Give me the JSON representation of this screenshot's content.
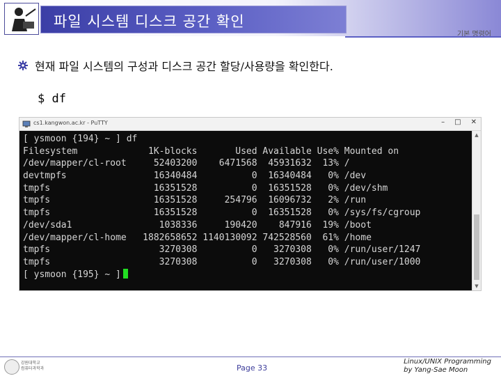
{
  "header": {
    "title": "파일 시스템 디스크 공간 확인",
    "tagline": "기본 명령어"
  },
  "bullet": {
    "text": "현재 파일 시스템의 구성과 디스크 공간 할당/사용량을 확인한다."
  },
  "command": {
    "text": "$ df"
  },
  "window": {
    "title": "cs1.kangwon.ac.kr - PuTTY",
    "controls": {
      "minimize": "–",
      "maximize": "□",
      "close": "✕"
    }
  },
  "terminal": {
    "lines": [
      "[ ysmoon {194} ~ ] df",
      "Filesystem             1K-blocks       Used Available Use% Mounted on",
      "/dev/mapper/cl-root     52403200    6471568  45931632  13% /",
      "devtmpfs                16340484          0  16340484   0% /dev",
      "tmpfs                   16351528          0  16351528   0% /dev/shm",
      "tmpfs                   16351528     254796  16096732   2% /run",
      "tmpfs                   16351528          0  16351528   0% /sys/fs/cgroup",
      "/dev/sda1                1038336     190420    847916  19% /boot",
      "/dev/mapper/cl-home   1882658652 1140130092 742528560  61% /home",
      "tmpfs                    3270308          0   3270308   0% /run/user/1247",
      "tmpfs                    3270308          0   3270308   0% /run/user/1000"
    ],
    "prompt": "[ ysmoon {195} ~ ]"
  },
  "footer": {
    "logo_text_1": "강원대학교",
    "logo_text_2": "컴퓨터과학과",
    "page": "Page 33",
    "credit_line1": "Linux/UNIX Programming",
    "credit_line2": "by Yang-Sae Moon"
  },
  "colors": {
    "title_bg": "#3b3ea6",
    "terminal_bg": "#0c0c0c",
    "terminal_fg": "#d6d6d6",
    "cursor": "#22dd22"
  }
}
